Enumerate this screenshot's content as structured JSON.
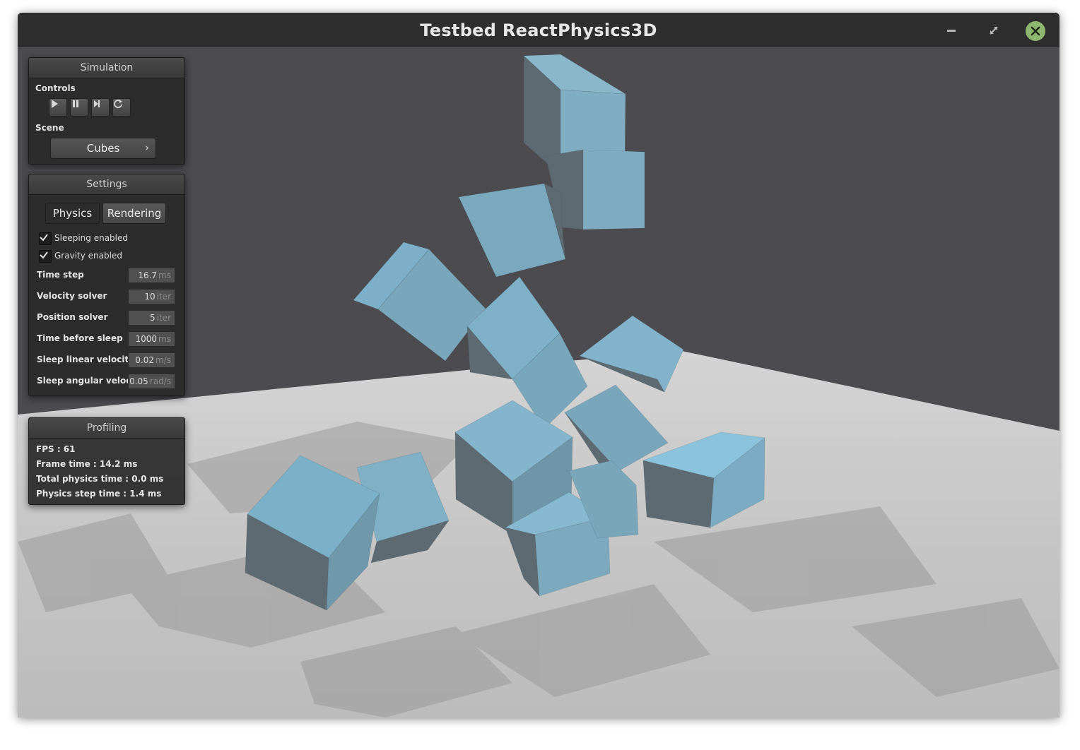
{
  "window": {
    "title": "Testbed ReactPhysics3D",
    "buttons": {
      "minimize": "minimize-icon",
      "maximize": "maximize-icon",
      "close": "close-icon"
    },
    "close_color": "#8fb66f"
  },
  "simulation": {
    "title": "Simulation",
    "controls_label": "Controls",
    "controls": [
      "play-icon",
      "pause-icon",
      "step-icon",
      "restart-icon"
    ],
    "scene_label": "Scene",
    "scene_value": "Cubes"
  },
  "settings": {
    "title": "Settings",
    "tabs": [
      {
        "label": "Physics",
        "active": true
      },
      {
        "label": "Rendering",
        "active": false
      }
    ],
    "checkboxes": [
      {
        "label": "Sleeping enabled",
        "checked": true
      },
      {
        "label": "Gravity enabled",
        "checked": true
      }
    ],
    "params": [
      {
        "label": "Time step",
        "value": "16.7",
        "unit": "ms"
      },
      {
        "label": "Velocity solver",
        "value": "10",
        "unit": "iter"
      },
      {
        "label": "Position solver",
        "value": "5",
        "unit": "iter"
      },
      {
        "label": "Time before sleep",
        "value": "1000",
        "unit": "ms"
      },
      {
        "label": "Sleep linear velocity",
        "value": "0.02",
        "unit": "m/s"
      },
      {
        "label": "Sleep angular velocity",
        "value": "0.05",
        "unit": "rad/s"
      }
    ]
  },
  "profiling": {
    "title": "Profiling",
    "lines": [
      "FPS : 61",
      "Frame time : 14.2 ms",
      "Total physics time : 0.0 ms",
      "Physics step time : 1.4 ms"
    ]
  },
  "scene_colors": {
    "background": "#4c4b50",
    "floor": "#c9c9c9",
    "cube_top": "#7fb0c6",
    "cube_side": "#5d6a72"
  }
}
